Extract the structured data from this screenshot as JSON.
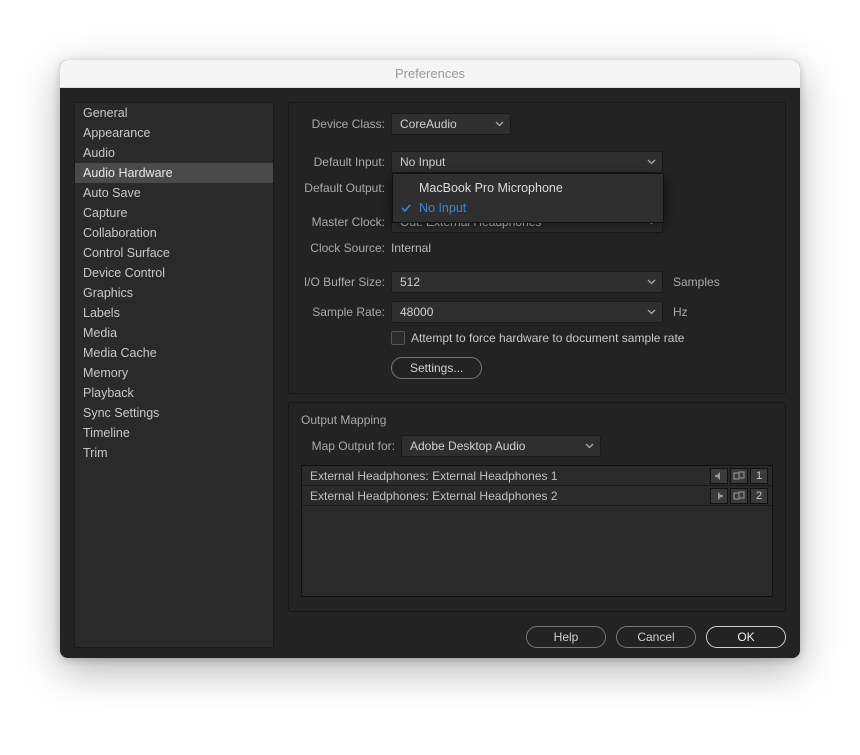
{
  "window": {
    "title": "Preferences"
  },
  "sidebar": {
    "items": [
      "General",
      "Appearance",
      "Audio",
      "Audio Hardware",
      "Auto Save",
      "Capture",
      "Collaboration",
      "Control Surface",
      "Device Control",
      "Graphics",
      "Labels",
      "Media",
      "Media Cache",
      "Memory",
      "Playback",
      "Sync Settings",
      "Timeline",
      "Trim"
    ],
    "active_index": 3
  },
  "panel1": {
    "device_class_label": "Device Class:",
    "device_class_value": "CoreAudio",
    "default_input_label": "Default Input:",
    "default_input_value": "No Input",
    "default_input_options": [
      "MacBook Pro Microphone",
      "No Input"
    ],
    "default_input_selected": "No Input",
    "default_output_label": "Default Output:",
    "master_clock_label": "Master Clock:",
    "master_clock_value": "Out: External Headphones",
    "clock_source_label": "Clock Source:",
    "clock_source_value": "Internal",
    "io_buffer_label": "I/O Buffer Size:",
    "io_buffer_value": "512",
    "io_buffer_unit": "Samples",
    "sample_rate_label": "Sample Rate:",
    "sample_rate_value": "48000",
    "sample_rate_unit": "Hz",
    "force_hw_label": "Attempt to force hardware to document sample rate",
    "settings_btn": "Settings..."
  },
  "panel2": {
    "title": "Output Mapping",
    "map_output_label": "Map Output for:",
    "map_output_value": "Adobe Desktop Audio",
    "rows": [
      {
        "label": "External Headphones: External Headphones 1",
        "channel": "1"
      },
      {
        "label": "External Headphones: External Headphones 2",
        "channel": "2"
      }
    ]
  },
  "footer": {
    "help": "Help",
    "cancel": "Cancel",
    "ok": "OK"
  },
  "icons": {
    "chevron": "chevron-down-icon",
    "check": "checkmark-icon",
    "speaker_l": "speaker-left-icon",
    "speaker_r": "speaker-right-icon",
    "link": "output-map-icon"
  }
}
